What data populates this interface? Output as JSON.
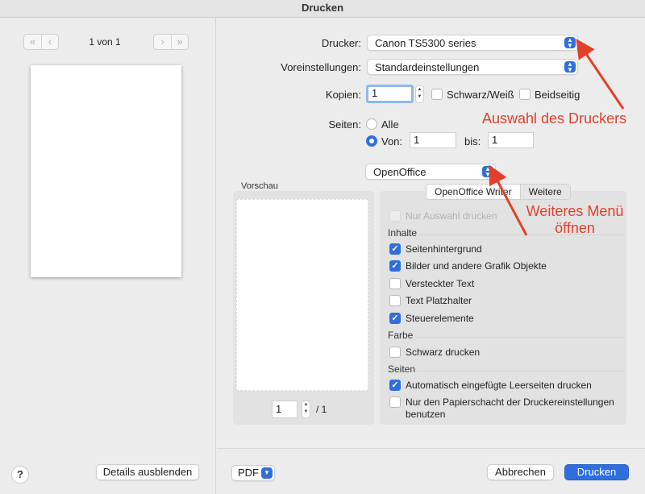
{
  "window": {
    "title": "Drucken"
  },
  "sidebar": {
    "page_counter": "1 von 1",
    "nav_icons": [
      "first-page-icon",
      "prev-page-icon",
      "next-page-icon",
      "last-page-icon"
    ],
    "help_label": "?",
    "details_button": "Details ausblenden"
  },
  "settings": {
    "printer_label": "Drucker:",
    "printer_value": "Canon TS5300 series",
    "presets_label": "Voreinstellungen:",
    "presets_value": "Standardeinstellungen",
    "copies_label": "Kopien:",
    "copies_value": "1",
    "bw_label": "Schwarz/Weiß",
    "bw_checked": false,
    "duplex_label": "Beidseitig",
    "duplex_checked": false,
    "pages_label": "Seiten:",
    "all_label": "Alle",
    "all_selected": false,
    "from_label": "Von:",
    "from_selected": true,
    "from_value": "1",
    "to_label": "bis:",
    "to_value": "1",
    "app_menu_value": "OpenOffice"
  },
  "preview": {
    "label": "Vorschau",
    "page_value": "1",
    "page_total": "/ 1"
  },
  "options": {
    "tabs": [
      {
        "label": "OpenOffice Writer",
        "selected": true
      },
      {
        "label": "Weitere",
        "selected": false
      }
    ],
    "only_selection": {
      "label": "Nur Auswahl drucken",
      "checked": false,
      "disabled": true
    },
    "contents_heading": "Inhalte",
    "contents": [
      {
        "label": "Seitenhintergrund",
        "checked": true
      },
      {
        "label": "Bilder und andere Grafik Objekte",
        "checked": true
      },
      {
        "label": "Versteckter Text",
        "checked": false
      },
      {
        "label": "Text Platzhalter",
        "checked": false
      },
      {
        "label": "Steuerelemente",
        "checked": true
      }
    ],
    "color_heading": "Farbe",
    "color_items": [
      {
        "label": "Schwarz drucken",
        "checked": false
      }
    ],
    "pages_heading": "Seiten",
    "pages_items": [
      {
        "label": "Automatisch eingefügte Leerseiten drucken",
        "checked": true
      },
      {
        "label": "Nur den Papierschacht der Druckereinstellungen",
        "label2": "benutzen",
        "checked": false
      }
    ]
  },
  "footer": {
    "pdf_label": "PDF",
    "cancel_label": "Abbrechen",
    "print_label": "Drucken"
  },
  "annotations": {
    "printer_note": "Auswahl des Druckers",
    "menu_note_line1": "Weiteres Menü",
    "menu_note_line2": "öffnen",
    "color": "#e2402a"
  }
}
